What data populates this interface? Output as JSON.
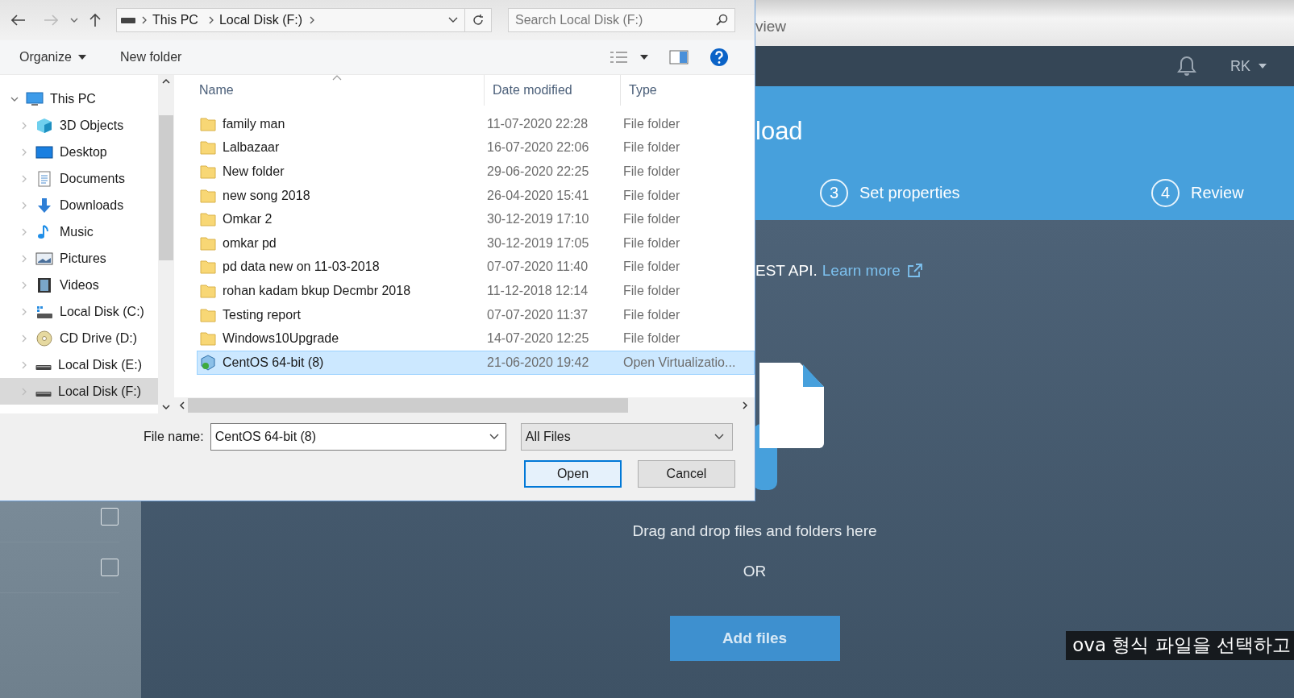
{
  "browser": {
    "tab_text": "view"
  },
  "header": {
    "user": "RK"
  },
  "banner": {
    "title": "load",
    "steps": [
      {
        "number": "3",
        "label": "Set properties"
      },
      {
        "number": "4",
        "label": "Review"
      }
    ]
  },
  "info": {
    "text": "EST API.",
    "link": "Learn more"
  },
  "dropzone": {
    "text": "Drag and drop files and folders here",
    "or": "OR",
    "button": "Add files"
  },
  "list_rows": [
    {
      "checked": false
    },
    {
      "checked": false
    }
  ],
  "subtitle": "ova 형식 파일을 선택하고",
  "dialog": {
    "breadcrumb": [
      "This PC",
      "Local Disk (F:)"
    ],
    "search_placeholder": "Search Local Disk (F:)",
    "organize": "Organize",
    "new_folder": "New folder",
    "nav": [
      {
        "label": "This PC",
        "kind": "pc",
        "expanded": true,
        "selected": false,
        "children": [
          {
            "label": "3D Objects",
            "kind": "objects",
            "expanded": false,
            "selected": false
          },
          {
            "label": "Desktop",
            "kind": "desktop",
            "expanded": false,
            "selected": false
          },
          {
            "label": "Documents",
            "kind": "documents",
            "expanded": false,
            "selected": false
          },
          {
            "label": "Downloads",
            "kind": "downloads",
            "expanded": false,
            "selected": false
          },
          {
            "label": "Music",
            "kind": "music",
            "expanded": false,
            "selected": false
          },
          {
            "label": "Pictures",
            "kind": "pictures",
            "expanded": false,
            "selected": false
          },
          {
            "label": "Videos",
            "kind": "videos",
            "expanded": false,
            "selected": false
          },
          {
            "label": "Local Disk (C:)",
            "kind": "system",
            "expanded": false,
            "selected": false
          },
          {
            "label": "CD Drive (D:)",
            "kind": "cd",
            "expanded": false,
            "selected": false
          },
          {
            "label": "Local Disk (E:)",
            "kind": "disk",
            "expanded": false,
            "selected": false
          },
          {
            "label": "Local Disk (F:)",
            "kind": "disk",
            "expanded": false,
            "selected": true
          }
        ]
      }
    ],
    "columns": [
      "Name",
      "Date modified",
      "Type"
    ],
    "files": [
      {
        "name": "family man",
        "date": "11-07-2020 22:28",
        "type": "File folder",
        "kind": "folder",
        "selected": false
      },
      {
        "name": "Lalbazaar",
        "date": "16-07-2020 22:06",
        "type": "File folder",
        "kind": "folder",
        "selected": false
      },
      {
        "name": "New folder",
        "date": "29-06-2020 22:25",
        "type": "File folder",
        "kind": "folder",
        "selected": false
      },
      {
        "name": "new song 2018",
        "date": "26-04-2020 15:41",
        "type": "File folder",
        "kind": "folder",
        "selected": false
      },
      {
        "name": "Omkar 2",
        "date": "30-12-2019 17:10",
        "type": "File folder",
        "kind": "folder",
        "selected": false
      },
      {
        "name": "omkar pd",
        "date": "30-12-2019 17:05",
        "type": "File folder",
        "kind": "folder",
        "selected": false
      },
      {
        "name": "pd data new on 11-03-2018",
        "date": "07-07-2020 11:40",
        "type": "File folder",
        "kind": "folder",
        "selected": false
      },
      {
        "name": "rohan kadam bkup Decmbr 2018",
        "date": "11-12-2018 12:14",
        "type": "File folder",
        "kind": "folder",
        "selected": false
      },
      {
        "name": "Testing report",
        "date": "07-07-2020 11:37",
        "type": "File folder",
        "kind": "folder",
        "selected": false
      },
      {
        "name": "Windows10Upgrade",
        "date": "14-07-2020 12:25",
        "type": "File folder",
        "kind": "folder",
        "selected": false
      },
      {
        "name": "CentOS 64-bit (8)",
        "date": "21-06-2020 19:42",
        "type": "Open Virtualizatio...",
        "kind": "appliance",
        "selected": true
      }
    ],
    "file_name_label": "File name:",
    "file_name": "CentOS 64-bit (8)",
    "filter": "All Files",
    "open": "Open",
    "cancel": "Cancel"
  }
}
